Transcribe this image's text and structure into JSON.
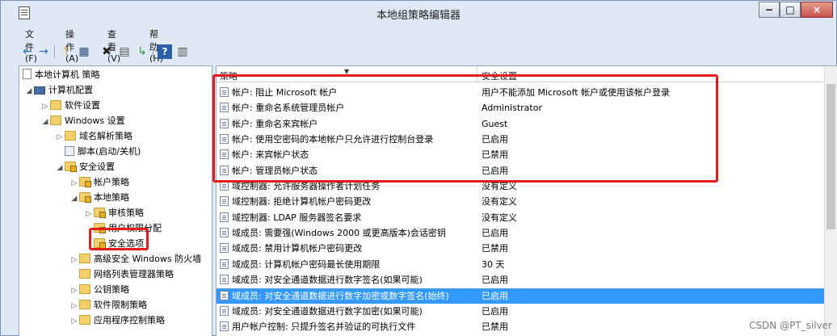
{
  "window": {
    "title": "本地组策略编辑器"
  },
  "title_buttons": {
    "minimize": "−",
    "maximize": "□",
    "close": "×"
  },
  "menu": [
    {
      "label": "文件(F)"
    },
    {
      "label": "操作(A)"
    },
    {
      "label": "查看(V)"
    },
    {
      "label": "帮助(H)"
    }
  ],
  "toolbar": {
    "back": "←",
    "forward": "→",
    "up": "↑",
    "show_hide": "▦",
    "delete": "✖",
    "properties": "▤",
    "export": "↳",
    "help": "?",
    "view": "▥"
  },
  "tree": {
    "root": "本地计算机 策略",
    "computer_config": "计算机配置",
    "software_settings": "软件设置",
    "windows_settings": "Windows 设置",
    "dns_policy": "域名解析策略",
    "scripts": "脚本(启动/关机)",
    "security_settings": "安全设置",
    "account_policy": "帐户策略",
    "local_policy": "本地策略",
    "audit_policy": "审核策略",
    "user_rights": "用户权限分配",
    "security_options": "安全选项",
    "firewall": "高级安全 Windows 防火墙",
    "network_list": "网络列表管理器策略",
    "public_key": "公钥策略",
    "software_restriction": "软件限制策略",
    "app_control": "应用程序控制策略"
  },
  "columns": {
    "policy": "策略",
    "setting": "安全设置"
  },
  "policies": [
    {
      "name": "帐户: 阻止 Microsoft 帐户",
      "setting": "用户不能添加 Microsoft 帐户或使用该帐户登录"
    },
    {
      "name": "帐户: 重命名系统管理员帐户",
      "setting": "Administrator"
    },
    {
      "name": "帐户: 重命名来宾帐户",
      "setting": "Guest"
    },
    {
      "name": "帐户: 使用空密码的本地帐户只允许进行控制台登录",
      "setting": "已启用"
    },
    {
      "name": "帐户: 来宾帐户状态",
      "setting": "已禁用"
    },
    {
      "name": "帐户: 管理员帐户状态",
      "setting": "已启用"
    },
    {
      "name": "域控制器: 允许服务器操作者计划任务",
      "setting": "没有定义"
    },
    {
      "name": "域控制器: 拒绝计算机帐户密码更改",
      "setting": "没有定义"
    },
    {
      "name": "域控制器: LDAP 服务器签名要求",
      "setting": "没有定义"
    },
    {
      "name": "域成员: 需要强(Windows 2000 或更高版本)会话密钥",
      "setting": "已启用"
    },
    {
      "name": "域成员: 禁用计算机帐户密码更改",
      "setting": "已禁用"
    },
    {
      "name": "域成员: 计算机帐户密码最长使用期限",
      "setting": "30 天"
    },
    {
      "name": "域成员: 对安全通道数据进行数字签名(如果可能)",
      "setting": "已启用"
    },
    {
      "name": "域成员: 对安全通道数据进行数字加密或数字签名(始终)",
      "setting": "已启用"
    },
    {
      "name": "域成员: 对安全通道数据进行数字加密(如果可能)",
      "setting": "已启用"
    },
    {
      "name": "用户帐户控制: 只提升签名并验证的可执行文件",
      "setting": "已禁用"
    }
  ],
  "colors": {
    "selection": "#3399ff",
    "annotation": "#e31b1b"
  },
  "watermark": "CSDN @PT_silver"
}
